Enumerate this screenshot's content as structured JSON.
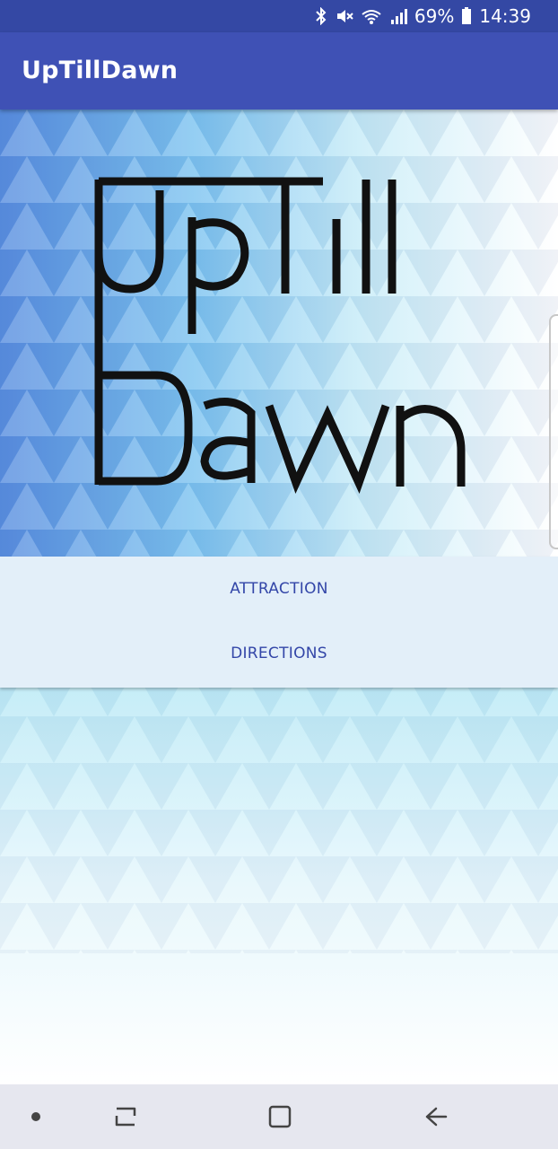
{
  "status_bar": {
    "battery": "69%",
    "time": "14:39",
    "icons": [
      "bluetooth-icon",
      "mute-icon",
      "wifi-icon",
      "signal-icon",
      "battery-icon"
    ]
  },
  "app_bar": {
    "title": "UpTillDawn"
  },
  "logo": {
    "text_line1": "UpTill",
    "text_line2": "Dawn"
  },
  "menu": {
    "items": [
      {
        "label": "ATTRACTION"
      },
      {
        "label": "DIRECTIONS"
      }
    ]
  },
  "nav_bar": {
    "icons": [
      "dot-icon",
      "recent-apps-icon",
      "home-icon",
      "back-icon"
    ]
  },
  "colors": {
    "status_bar": "#3448a4",
    "app_bar": "#3f51b5",
    "menu_bg": "#e3eff9",
    "menu_text": "#3346a8",
    "nav_bar": "#e6e7ef"
  }
}
